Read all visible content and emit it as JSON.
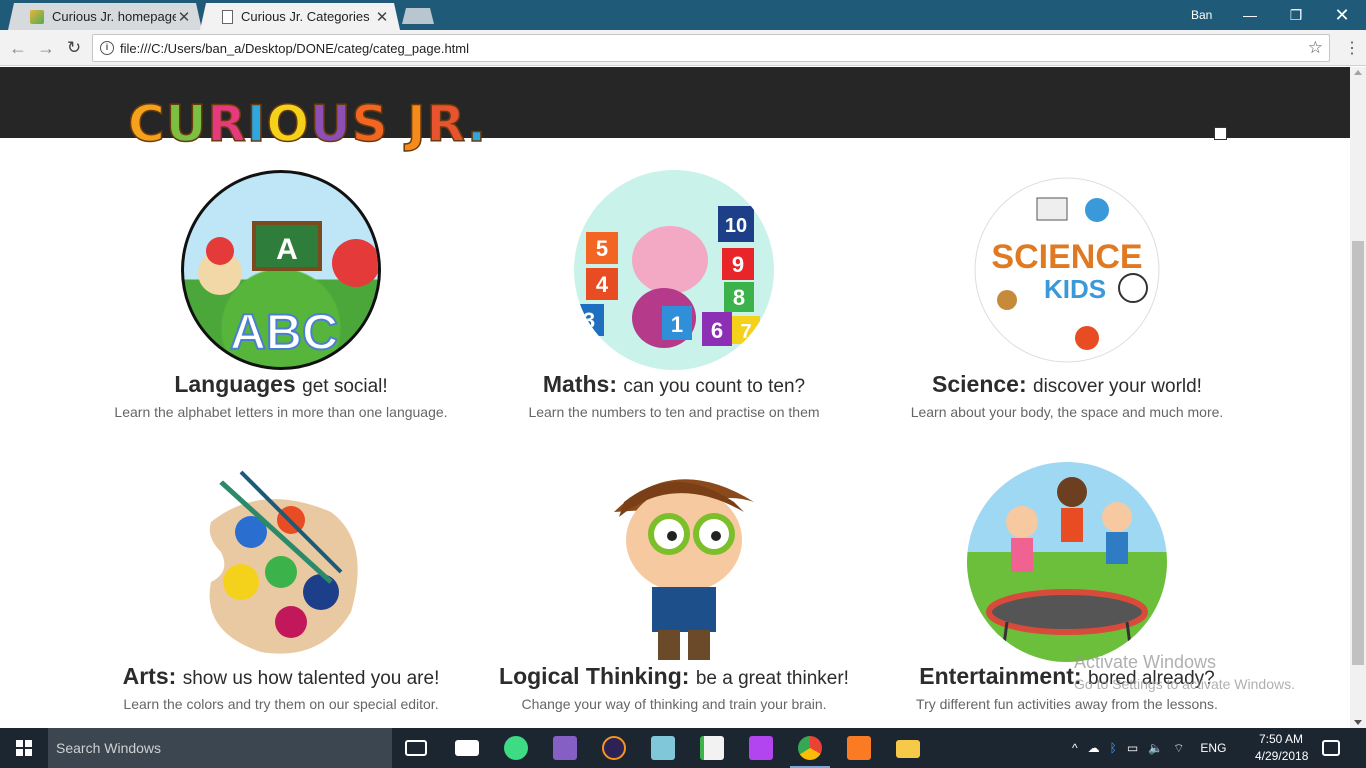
{
  "browser": {
    "tabs": [
      {
        "title": "Curious Jr. homepage",
        "active": false
      },
      {
        "title": "Curious Jr. Categories",
        "active": true
      }
    ],
    "close_glyph": "✕",
    "user": "Ban",
    "url": "file:///C:/Users/ban_a/Desktop/DONE/categ/categ_page.html",
    "window_controls": {
      "minimize": "—",
      "maximize": "❐",
      "close": "✕"
    }
  },
  "page": {
    "logo_text": "CURIOUS JR.",
    "categories": [
      {
        "title": "Languages",
        "tagline": "get social!",
        "description": "Learn the alphabet letters in more than one language.",
        "image_icon": "abc-clowns-icon"
      },
      {
        "title": "Maths:",
        "tagline": "can you count to ten?",
        "description": "Learn the numbers to ten and practise on them",
        "image_icon": "elephant-numbers-icon"
      },
      {
        "title": "Science:",
        "tagline": "discover your world!",
        "description": "Learn about your body, the space and much more.",
        "image_icon": "science-kids-icon"
      },
      {
        "title": "Arts:",
        "tagline": "show us how talented you are!",
        "description": "Learn the colors and try them on our special editor.",
        "image_icon": "paint-palette-icon"
      },
      {
        "title": "Logical Thinking:",
        "tagline": "be a great thinker!",
        "description": "Change your way of thinking and train your brain.",
        "image_icon": "thinking-boy-icon"
      },
      {
        "title": "Entertainment:",
        "tagline": "bored already?",
        "description": "Try different fun activities away from the lessons.",
        "image_icon": "trampoline-kids-icon"
      }
    ],
    "watermark": {
      "title": "Activate Windows",
      "subtitle": "Go to Settings to activate Windows."
    }
  },
  "taskbar": {
    "search_placeholder": "Search Windows",
    "language": "ENG",
    "time": "7:50 AM",
    "date": "4/29/2018"
  },
  "colors": {
    "titlebar": "#1f5a78",
    "header_band": "#262626",
    "taskbar": "#1c2630"
  }
}
